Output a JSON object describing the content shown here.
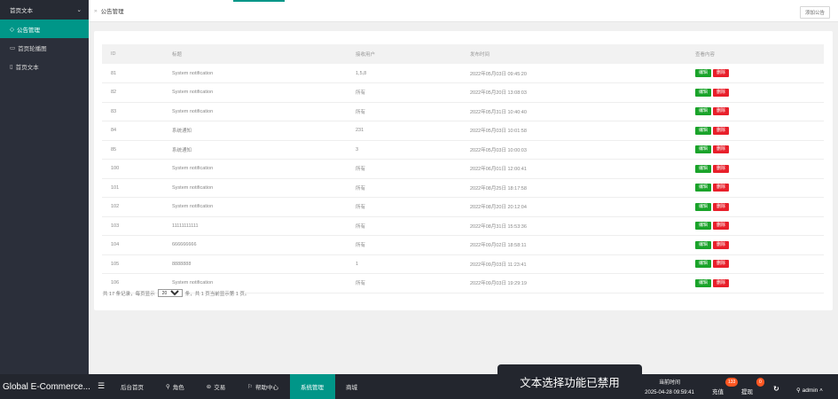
{
  "sidebar": {
    "header": "首页文本",
    "items": [
      {
        "icon": "◇",
        "label": "公告管理",
        "active": true
      },
      {
        "icon": "▭",
        "label": "首页轮播图",
        "active": false
      },
      {
        "icon": "▯",
        "label": "首页文本",
        "active": false
      }
    ]
  },
  "topbar": {
    "breadcrumb": "公告管理",
    "add_button": "添加公告"
  },
  "table": {
    "headers": [
      "ID",
      "标题",
      "接收用户",
      "发布时间",
      "查看内容"
    ],
    "edit_label": "编辑",
    "delete_label": "删除",
    "rows": [
      {
        "id": "81",
        "title": "System notification",
        "users": "1,5,8",
        "time": "2022年05月03日 09:45:20"
      },
      {
        "id": "82",
        "title": "System notification",
        "users": "所有",
        "time": "2022年05月20日 13:08:03"
      },
      {
        "id": "83",
        "title": "System notification",
        "users": "所有",
        "time": "2022年05月31日 10:40:40"
      },
      {
        "id": "84",
        "title": "系统通知",
        "users": "231",
        "time": "2022年05月03日 10:01:58"
      },
      {
        "id": "85",
        "title": "系统通知",
        "users": "3",
        "time": "2022年05月03日 10:00:03"
      },
      {
        "id": "100",
        "title": "System notification",
        "users": "所有",
        "time": "2022年06月01日 12:00:41"
      },
      {
        "id": "101",
        "title": "System notification",
        "users": "所有",
        "time": "2022年08月25日 18:17:58"
      },
      {
        "id": "102",
        "title": "System notification",
        "users": "所有",
        "time": "2022年08月20日 20:12:04"
      },
      {
        "id": "103",
        "title": "11111111111",
        "users": "所有",
        "time": "2022年08月31日 15:53:36"
      },
      {
        "id": "104",
        "title": "666666666",
        "users": "所有",
        "time": "2022年09月02日 18:58:11"
      },
      {
        "id": "105",
        "title": "8888888",
        "users": "1",
        "time": "2022年09月03日 11:23:41"
      },
      {
        "id": "106",
        "title": "System notification",
        "users": "所有",
        "time": "2022年09月03日 19:29:19"
      }
    ]
  },
  "pager": {
    "prefix": "共 17 条记录，每页显示",
    "page_size": "20",
    "suffix": "条，共 1 页当前显示第 1 页。"
  },
  "taskbar": {
    "app_name": "Global E-Commerce...",
    "nav": [
      {
        "icon": "",
        "label": "后台首页",
        "active": false
      },
      {
        "icon": "⚲",
        "label": "角色",
        "active": false
      },
      {
        "icon": "⊜",
        "label": "交易",
        "active": false
      },
      {
        "icon": "⚐",
        "label": "帮助中心",
        "active": false
      },
      {
        "icon": "",
        "label": "系统管理",
        "active": true
      },
      {
        "icon": "",
        "label": "商城",
        "active": false
      }
    ],
    "toast": "文本选择功能已禁用",
    "time_label": "当前时间",
    "time_value": "2025-04-28 09:59:41",
    "recharge": "充值",
    "recharge_badge": "133",
    "withdraw": "提现",
    "withdraw_badge": "0",
    "user": "admin"
  },
  "colors": {
    "accent": "#009688",
    "edit": "#1aa32a",
    "delete": "#e8202b",
    "badge": "#ff5722"
  }
}
